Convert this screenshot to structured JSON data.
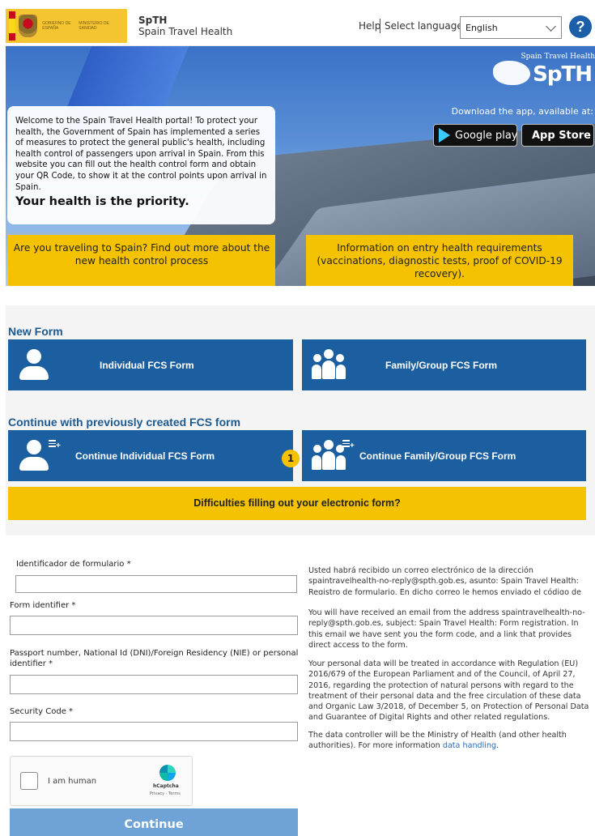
{
  "header": {
    "gov_line1": "GOBIERNO DE ESPAÑA",
    "gov_line2": "MINISTERIO DE SANIDAD",
    "brand_short": "SpTH",
    "brand_long": "Spain Travel Health",
    "help": "Help",
    "select_language_label": "Select language:",
    "language_value": "English",
    "help_icon_glyph": "?"
  },
  "hero": {
    "logo_top": "Spain Travel Health",
    "logo_main": "SpTH",
    "download_text": "Download the app, available at:",
    "google_play": "Google play",
    "app_store": "App Store",
    "welcome_text": "Welcome to the Spain Travel Health portal! To protect your health, the Government of Spain has implemented a series of measures to protect the general public's health, including health control of passengers upon arrival in Spain. From this website you can fill out the health control form and obtain your QR Code, to show it at the control points upon arrival in Spain.",
    "welcome_strong": "Your health is the priority.",
    "yellow_btn_1": "Are you traveling to Spain? Find out more about the new health control process",
    "yellow_btn_2": "Information on entry health requirements (vaccinations, diagnostic tests, proof of COVID-19 recovery)."
  },
  "forms": {
    "new_form_title": "New Form",
    "individual": "Individual FCS Form",
    "family": "Family/Group FCS Form",
    "continue_title": "Continue with previously created FCS form",
    "continue_individual": "Continue Individual FCS Form",
    "continue_family": "Continue Family/Group FCS Form",
    "badge": "1",
    "difficulties": "Difficulties filling out your electronic form?"
  },
  "login": {
    "esp_form_id_label": "Identificador de formulario *",
    "form_id_label": "Form identifier *",
    "passport_label": "Passport number, National Id (DNI)/Foreign Residency (NIE) or personal identifier *",
    "security_label": "Security Code *",
    "captcha_text": "I am human",
    "captcha_brand": "hCaptcha",
    "captcha_terms": "Privacy - Terms",
    "continue": "Continue"
  },
  "info": {
    "esp_text": "Usted habrá recibido un correo electrónico de la dirección spaintravelhealth-no-reply@spth.gob.es, asunto: Spain Travel Health: Registro de formulario. En dicho correo le hemos enviado el código de",
    "para1": "You will have received an email from the address spaintravelhealth-no-reply@spth.gob.es, subject: Spain Travel Health: Form registration. In this email we have sent you the form code, and a link that provides direct access to the form.",
    "para2": "Your personal data will be treated in accordance with Regulation (EU) 2016/679 of the European Parliament and of the Council, of April 27, 2016, regarding the protection of natural persons with regard to the treatment of their personal data and the free circulation of these data and Organic Law 3/2018, of December 5, on Protection of Personal Data and Guarantee of Digital Rights and other related regulations.",
    "para3": "The data controller will be the Ministry of Health (and other health authorities). For more information",
    "para3_link": "data handling",
    "para3_end": "."
  },
  "colors": {
    "brand_blue": "#1b5fa0",
    "accent_yellow": "#f5c200",
    "continue_blue": "#6fa2d6",
    "title_blue": "#1d5a8f"
  }
}
